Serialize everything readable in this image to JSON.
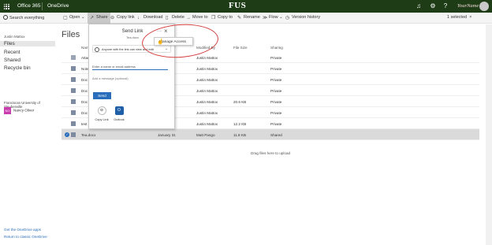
{
  "suite": {
    "app": "Office 365",
    "product": "OneDrive",
    "logo": "FUS",
    "user": "YourName"
  },
  "search": {
    "placeholder": "Search everything"
  },
  "commands": [
    {
      "label": "Open",
      "icon": "open-icon",
      "chev": "⌄"
    },
    {
      "label": "Share",
      "icon": "share-icon"
    },
    {
      "label": "Copy link",
      "icon": "link-icon"
    },
    {
      "label": "Download",
      "icon": "download-icon"
    },
    {
      "label": "Delete",
      "icon": "trash-icon"
    },
    {
      "label": "Move to",
      "icon": "move-icon"
    },
    {
      "label": "Copy to",
      "icon": "copy-icon"
    },
    {
      "label": "Rename",
      "icon": "rename-icon"
    },
    {
      "label": "Flow",
      "icon": "flow-icon",
      "chev": "⌄"
    },
    {
      "label": "Version history",
      "icon": "history-icon"
    }
  ],
  "selection": {
    "text": "1 selected",
    "close": "×"
  },
  "nav": {
    "user": "Justin Mattox",
    "items": [
      "Files",
      "Recent",
      "Shared",
      "Recycle bin"
    ],
    "group": "Franciscan University of Steubenville",
    "person": "Nancy Oliver",
    "bottom_links": [
      "Get the OneDrive apps",
      "Return to classic OneDrive"
    ]
  },
  "main": {
    "title": "Files",
    "columns": [
      "Name",
      "Modified By",
      "File Size",
      "Sharing"
    ],
    "rows": [
      {
        "name": "Attac",
        "date": "",
        "by": "Justin Mattox",
        "size": "",
        "sharing": "Private"
      },
      {
        "name": "Note",
        "date": "31",
        "by": "Justin Mattox",
        "size": "",
        "sharing": "Private"
      },
      {
        "name": "Doc",
        "date": "",
        "by": "Justin Mattox",
        "size": "",
        "sharing": "Private"
      },
      {
        "name": "Doc",
        "date": "",
        "by": "Justin Mattox",
        "size": "",
        "sharing": "Private"
      },
      {
        "name": "Doc",
        "date": "",
        "by": "Justin Mattox",
        "size": "20.6 KB",
        "sharing": "Private"
      },
      {
        "name": "Doc",
        "date": "",
        "by": "Justin Mattox",
        "size": "",
        "sharing": "Private"
      },
      {
        "name": "test",
        "date": "",
        "by": "Justin Mattox",
        "size": "12.2 KB",
        "sharing": "Private"
      },
      {
        "name": "Tea.docx",
        "date": "January 31",
        "by": "Matt Pango",
        "size": "11.8 KB",
        "sharing": "Shared"
      }
    ],
    "drop_hint": "Drag files here to upload"
  },
  "share_dialog": {
    "title": "Send Link",
    "subtitle": "Tea.docx",
    "more": "···",
    "close": "×",
    "link_setting": "Anyone with the link can view and edit",
    "email_placeholder": "Enter a name or email address",
    "message_placeholder": "Add a message (optional)",
    "send": "Send",
    "options": [
      {
        "label": "Copy Link",
        "glyph": "⊖"
      },
      {
        "label": "Outlook",
        "glyph": "O"
      }
    ]
  },
  "manage_access": {
    "label": "Manage Access"
  }
}
